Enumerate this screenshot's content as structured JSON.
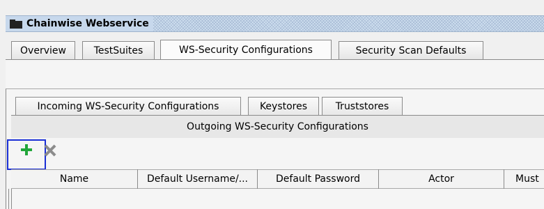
{
  "window": {
    "title": "Chainwise Webservice",
    "icon": "folder-icon"
  },
  "outer_tabs": [
    {
      "label": "Overview"
    },
    {
      "label": "TestSuites"
    },
    {
      "label": "WS-Security Configurations",
      "selected": true
    },
    {
      "label": "Security Scan Defaults"
    }
  ],
  "inner_tabs": [
    {
      "label": "Incoming WS-Security Configurations"
    },
    {
      "label": "Keystores"
    },
    {
      "label": "Truststores"
    }
  ],
  "selected_inner_tab": {
    "label": "Outgoing WS-Security Configurations"
  },
  "toolbar": {
    "add_icon": "add-icon",
    "remove_icon": "remove-icon"
  },
  "table": {
    "columns": [
      {
        "label": "Name"
      },
      {
        "label": "Default Username/..."
      },
      {
        "label": "Default Password"
      },
      {
        "label": "Actor"
      },
      {
        "label": "Must"
      }
    ]
  },
  "colors": {
    "add_icon": "#22a63a",
    "remove_icon": "#8c8c8c",
    "highlight_box": "#1a2fd6",
    "title_bar": "#c7d8ec"
  }
}
